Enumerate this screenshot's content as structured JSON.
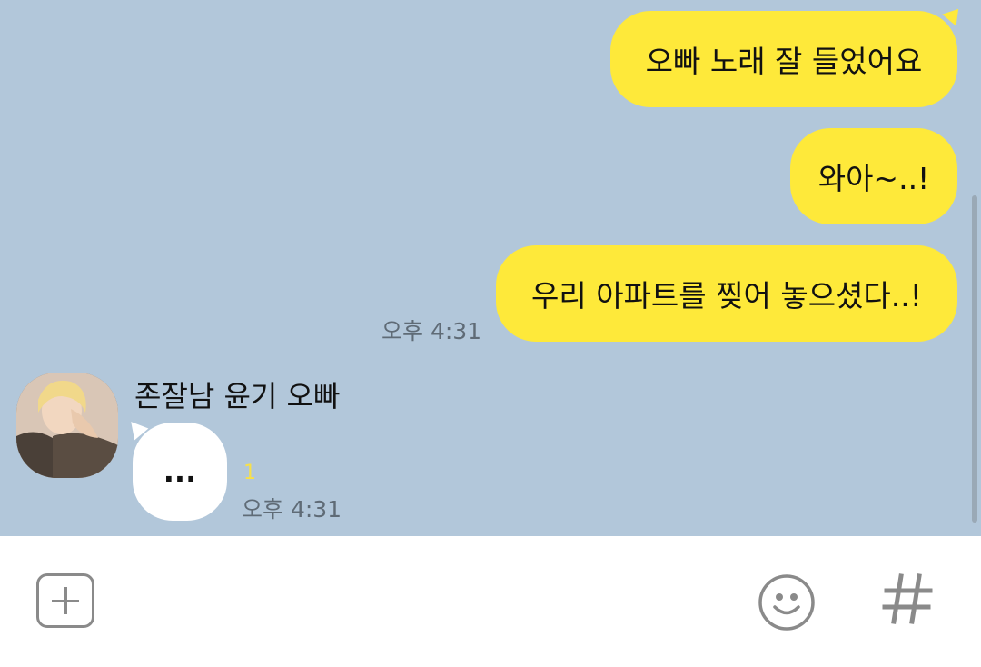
{
  "messages_out": [
    {
      "text": "오빠 노래 잘 들었어요"
    },
    {
      "text": "와아~..!"
    },
    {
      "text": "우리 아파트를 찢어 놓으셨다..!"
    }
  ],
  "out_time": "오후 4:31",
  "incoming": {
    "sender": "존잘남 윤기 오빠",
    "text": "...",
    "unread": "1",
    "time": "오후 4:31"
  },
  "colors": {
    "background": "#b2c7da",
    "bubble_out": "#fee93a",
    "bubble_in": "#ffffff",
    "unread": "#f7e04a"
  },
  "icons": [
    "plus-icon",
    "emoji-icon",
    "hashtag-icon"
  ]
}
